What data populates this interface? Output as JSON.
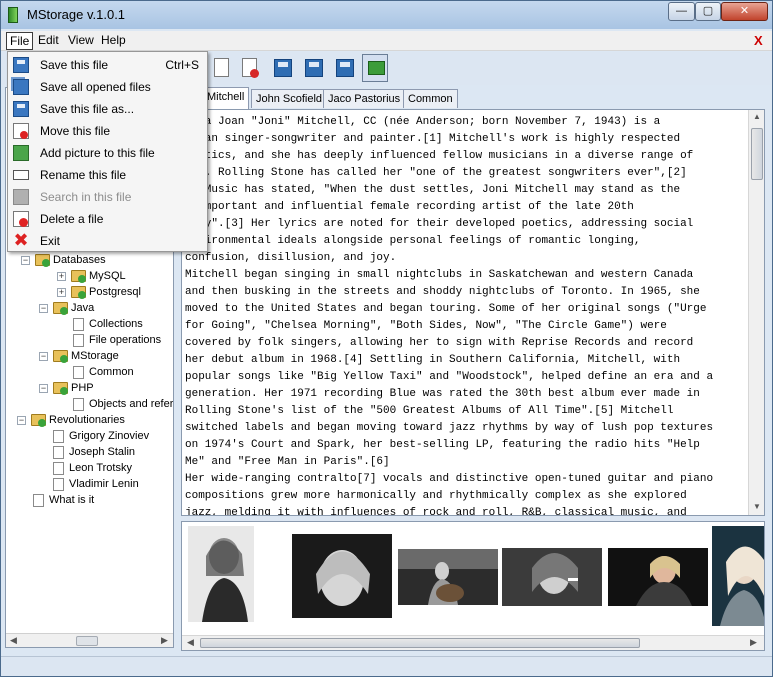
{
  "window": {
    "title": "MStorage v.1.0.1",
    "minimize_glyph": "—",
    "maximize_glyph": "▢",
    "close_glyph": "✕"
  },
  "menubar": {
    "file": "File",
    "edit": "Edit",
    "view": "View",
    "help": "Help",
    "close_doc": "X"
  },
  "file_menu": {
    "items": [
      {
        "label": "Save this file",
        "shortcut": "Ctrl+S",
        "icon": "save-icon",
        "enabled": true
      },
      {
        "label": "Save all opened files",
        "shortcut": "",
        "icon": "save-all-icon",
        "enabled": true
      },
      {
        "label": "Save this file as...",
        "shortcut": "",
        "icon": "save-as-icon",
        "enabled": true
      },
      {
        "label": "Move this file",
        "shortcut": "",
        "icon": "move-file-icon",
        "enabled": true
      },
      {
        "label": "Add picture to this file",
        "shortcut": "",
        "icon": "add-picture-icon",
        "enabled": true
      },
      {
        "label": "Rename this file",
        "shortcut": "",
        "icon": "rename-icon",
        "enabled": true
      },
      {
        "label": "Search in this file",
        "shortcut": "",
        "icon": "search-icon",
        "enabled": false
      },
      {
        "label": "Delete a file",
        "shortcut": "",
        "icon": "delete-file-icon",
        "enabled": true
      },
      {
        "label": "Exit",
        "shortcut": "",
        "icon": "exit-icon",
        "enabled": true
      }
    ]
  },
  "tree": {
    "nodes": [
      {
        "label": "Databases",
        "type": "folder"
      },
      {
        "label": "MySQL",
        "type": "folder"
      },
      {
        "label": "Postgresql",
        "type": "folder"
      },
      {
        "label": "Java",
        "type": "folder"
      },
      {
        "label": "Collections",
        "type": "file"
      },
      {
        "label": "File operations",
        "type": "file"
      },
      {
        "label": "MStorage",
        "type": "folder"
      },
      {
        "label": "Common",
        "type": "file"
      },
      {
        "label": "PHP",
        "type": "folder"
      },
      {
        "label": "Objects and refer",
        "type": "file"
      },
      {
        "label": "Revolutionaries",
        "type": "folder"
      },
      {
        "label": "Grigory Zinoviev",
        "type": "file"
      },
      {
        "label": "Joseph Stalin",
        "type": "file"
      },
      {
        "label": "Leon Trotsky",
        "type": "file"
      },
      {
        "label": "Vladimir Lenin",
        "type": "file"
      },
      {
        "label": "What is it",
        "type": "file"
      }
    ]
  },
  "tabs": [
    {
      "label": "Mitchell",
      "active": true
    },
    {
      "label": "John Scofield",
      "active": false
    },
    {
      "label": "Jaco Pastorius",
      "active": false
    },
    {
      "label": "Common",
      "active": false
    }
  ],
  "article": {
    "lines": [
      "erta Joan \"Joni\" Mitchell, CC (née Anderson; born November 7, 1943) is a",
      "adian singer-songwriter and painter.[1] Mitchell's work is highly respected",
      "critics, and she has deeply influenced fellow musicians in a diverse range of",
      "res. Rolling Stone has called her \"one of the greatest songwriters ever\",[2]",
      " AllMusic has stated, \"When the dust settles, Joni Mitchell may stand as the",
      "t important and influential female recording artist of the late 20th",
      "tury\".[3] Her lyrics are noted for their developed poetics, addressing social",
      " environmental ideals alongside personal feelings of romantic longing,",
      "confusion, disillusion, and joy.",
      "Mitchell began singing in small nightclubs in Saskatchewan and western Canada",
      "and then busking in the streets and shoddy nightclubs of Toronto. In 1965, she",
      "moved to the United States and began touring. Some of her original songs (\"Urge",
      "for Going\", \"Chelsea Morning\", \"Both Sides, Now\", \"The Circle Game\") were",
      "covered by folk singers, allowing her to sign with Reprise Records and record",
      "her debut album in 1968.[4] Settling in Southern California, Mitchell, with",
      "popular songs like \"Big Yellow Taxi\" and \"Woodstock\", helped define an era and a",
      "generation. Her 1971 recording Blue was rated the 30th best album ever made in",
      "Rolling Stone's list of the \"500 Greatest Albums of All Time\".[5] Mitchell",
      "switched labels and began moving toward jazz rhythms by way of lush pop textures",
      "on 1974's Court and Spark, her best-selling LP, featuring the radio hits \"Help",
      "Me\" and \"Free Man in Paris\".[6]",
      "Her wide-ranging contralto[7] vocals and distinctive open-tuned guitar and piano",
      "compositions grew more harmonically and rhythmically complex as she explored",
      "jazz, melding it with influences of rock and roll, R&B, classical music, and"
    ]
  },
  "colors": {
    "accent": "#2f6db3",
    "close_button": "#c1432c",
    "menu_close": "#cc0000"
  }
}
